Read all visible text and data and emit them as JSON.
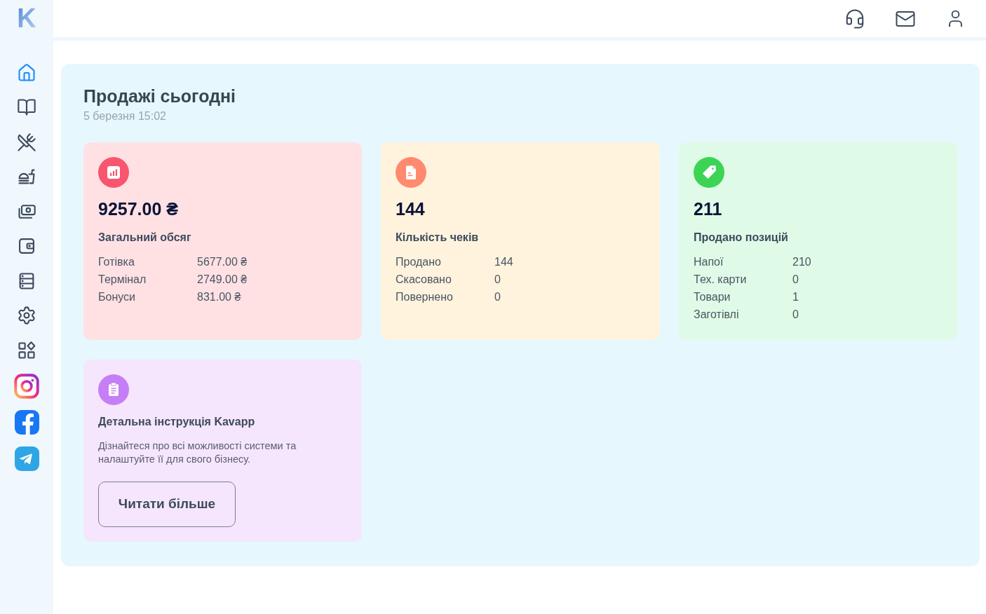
{
  "sidebar": {
    "logo": "K",
    "nav_items": [
      {
        "selected": true
      },
      {
        "selected": false
      },
      {
        "selected": false
      },
      {
        "selected": false
      },
      {
        "selected": false
      },
      {
        "selected": false
      },
      {
        "selected": false
      },
      {
        "selected": false
      },
      {
        "selected": false
      }
    ]
  },
  "sales": {
    "title": "Продажі сьогодні",
    "date": "5 березня 15:02",
    "cards": [
      {
        "kind": "stats",
        "value": "9257.00 ₴",
        "label": "Загальний обсяг",
        "rows": [
          {
            "name": "Готівка",
            "value": "5677.00 ₴"
          },
          {
            "name": "Термінал",
            "value": "2749.00 ₴"
          },
          {
            "name": "Бонуси",
            "value": "831.00 ₴"
          }
        ]
      },
      {
        "kind": "stats",
        "value": "144",
        "label": "Кількість чеків",
        "rows": [
          {
            "name": "Продано",
            "value": "144"
          },
          {
            "name": "Скасовано",
            "value": "0"
          },
          {
            "name": "Повернено",
            "value": "0"
          }
        ]
      },
      {
        "kind": "stats",
        "value": "211",
        "label": "Продано позицій",
        "rows": [
          {
            "name": "Напої",
            "value": "210"
          },
          {
            "name": "Тех. карти",
            "value": "0"
          },
          {
            "name": "Товари",
            "value": "1"
          },
          {
            "name": "Заготівлі",
            "value": "0"
          }
        ]
      },
      {
        "kind": "info",
        "title": "Детальна інструкція Kavapp",
        "text": "Дізнайтеся про всі можливості системи та налаштуйте її для свого бізнесу.",
        "button": "Читати більше"
      }
    ]
  }
}
